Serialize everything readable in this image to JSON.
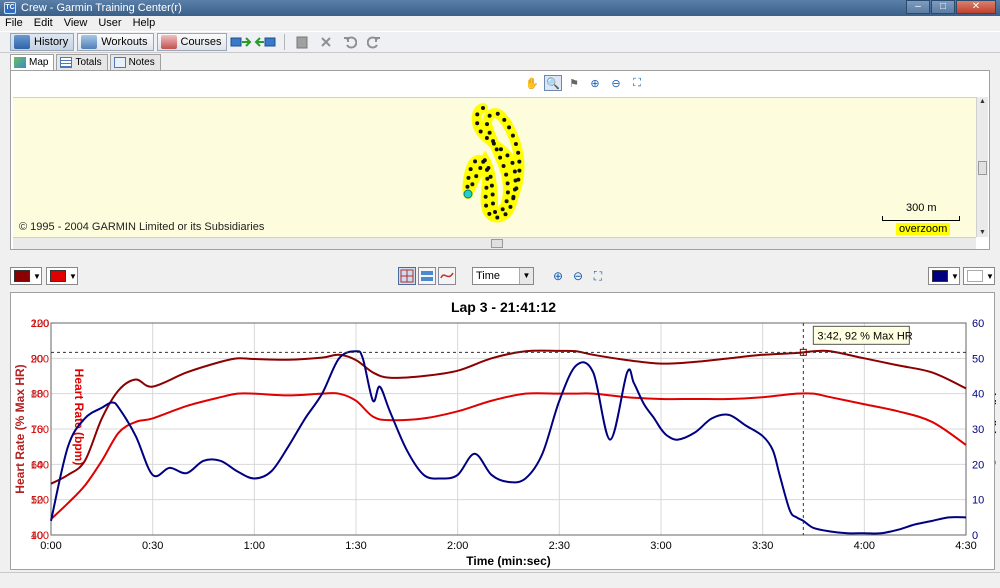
{
  "window": {
    "title": "Crew - Garmin Training Center(r)",
    "icon": "TC",
    "min": "–",
    "max": "□",
    "close": "✕"
  },
  "menu": [
    "File",
    "Edit",
    "View",
    "User",
    "Help"
  ],
  "toolbar": {
    "history": "History",
    "workouts": "Workouts",
    "courses": "Courses"
  },
  "tabs": {
    "map": "Map",
    "totals": "Totals",
    "notes": "Notes"
  },
  "map": {
    "copyright": "© 1995 - 2004 GARMIN Limited or its Subsidiaries",
    "scale": "300 m",
    "overzoom": "overzoom"
  },
  "chart_controls": {
    "x_axis_mode": "Time",
    "left_colors": [
      "#8b0000",
      "#e00000"
    ],
    "right_color": "#000080"
  },
  "chart_data": {
    "type": "line",
    "title": "Lap 3 - 21:41:12",
    "xlabel": "Time (min:sec)",
    "xlim": [
      0,
      270
    ],
    "xticks": [
      "0:00",
      "0:30",
      "1:00",
      "1:30",
      "2:00",
      "2:30",
      "3:00",
      "3:30",
      "4:00",
      "4:30"
    ],
    "axes": [
      {
        "label": "Heart Rate (% Max HR)",
        "color": "#b22222",
        "side": "left",
        "range": [
          40,
          100
        ],
        "ticks": [
          "40",
          "50",
          "60",
          "70",
          "80",
          "90",
          "100"
        ]
      },
      {
        "label": "Heart Rate (bpm)",
        "color": "#e00000",
        "side": "left",
        "range": [
          100,
          220
        ],
        "ticks": [
          "100",
          "120",
          "140",
          "160",
          "180",
          "200",
          "220"
        ]
      },
      {
        "label": "Speed (km/h)",
        "color": "#000080",
        "side": "right",
        "range": [
          0,
          60
        ],
        "ticks": [
          "0",
          "10",
          "20",
          "30",
          "40",
          "50",
          "60"
        ]
      }
    ],
    "series": [
      {
        "axis": 0,
        "color": "#8b0000",
        "x": [
          0,
          5,
          10,
          15,
          20,
          25,
          30,
          40,
          50,
          55,
          60,
          70,
          80,
          85,
          90,
          95,
          100,
          110,
          120,
          130,
          140,
          150,
          155,
          160,
          170,
          180,
          190,
          200,
          210,
          220,
          225,
          230,
          240,
          250,
          260,
          270
        ],
        "y": [
          54.5,
          57,
          61,
          73,
          81,
          84,
          82,
          86,
          89,
          90,
          89.8,
          89.6,
          90.2,
          91,
          89.5,
          86,
          84.5,
          85,
          86.5,
          90,
          92,
          92.1,
          92,
          91,
          89.5,
          88.5,
          89,
          90,
          91,
          91.5,
          92,
          92,
          90,
          88,
          86,
          81.5
        ]
      },
      {
        "axis": 1,
        "color": "#e00000",
        "x": [
          0,
          5,
          10,
          15,
          20,
          25,
          30,
          40,
          50,
          55,
          60,
          70,
          80,
          85,
          90,
          95,
          100,
          110,
          120,
          130,
          140,
          150,
          155,
          160,
          170,
          180,
          190,
          200,
          210,
          220,
          225,
          230,
          240,
          250,
          260,
          270
        ],
        "y": [
          109,
          118,
          128,
          142,
          158,
          164,
          166,
          173,
          178,
          180,
          180,
          179,
          180,
          180,
          176,
          167,
          165,
          166,
          170,
          176,
          180,
          180,
          180,
          180,
          178,
          177,
          177,
          177,
          178,
          180,
          180,
          178,
          174,
          170,
          164,
          151
        ]
      },
      {
        "axis": 2,
        "color": "#000080",
        "x": [
          0,
          5,
          10,
          15,
          18,
          20,
          25,
          30,
          35,
          40,
          45,
          50,
          55,
          60,
          65,
          70,
          75,
          80,
          85,
          90,
          92,
          95,
          97,
          100,
          105,
          110,
          115,
          120,
          125,
          130,
          135,
          140,
          145,
          150,
          155,
          160,
          165,
          170,
          172,
          175,
          178,
          180,
          182,
          185,
          190,
          195,
          200,
          205,
          210,
          213,
          215,
          218,
          220,
          222,
          225,
          230,
          235,
          240,
          245,
          250,
          255,
          260,
          265,
          270
        ],
        "y": [
          4,
          25,
          33,
          36,
          37.5,
          36,
          28,
          17,
          19,
          17.5,
          21,
          21,
          18,
          16,
          18,
          25,
          33,
          40,
          50,
          52,
          50,
          38,
          42,
          35,
          24,
          17,
          16,
          17,
          23,
          17,
          15,
          16,
          23,
          38,
          48,
          46,
          27,
          46,
          43,
          37,
          33,
          30,
          28,
          27,
          29,
          33,
          34,
          31,
          28,
          24,
          17,
          7,
          5,
          4,
          2,
          1,
          0.5,
          0.5,
          0.5,
          1.5,
          3,
          4,
          5,
          5
        ]
      }
    ],
    "cursor": {
      "x": 222,
      "label": "3:42, 92 % Max HR"
    }
  }
}
